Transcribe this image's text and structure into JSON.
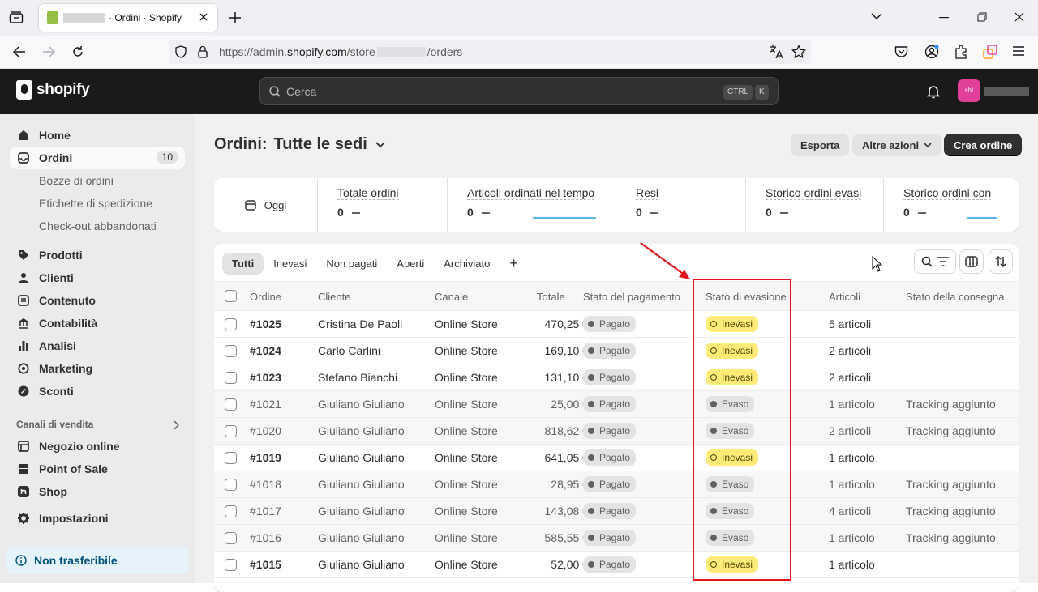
{
  "browser": {
    "tab_title": "· Ordini · Shopify",
    "url_prefix": "https://admin.",
    "url_domain": "shopify.com",
    "url_mid": "/store",
    "url_suffix": "/orders"
  },
  "topbar": {
    "logo": "shopify",
    "search_placeholder": "Cerca",
    "kbd_ctrl": "CTRL",
    "kbd_k": "K",
    "avatar": "sht"
  },
  "sidebar": {
    "home": "Home",
    "orders": "Ordini",
    "orders_count": "10",
    "drafts": "Bozze di ordini",
    "labels": "Etichette di spedizione",
    "abandoned": "Check-out abbandonati",
    "products": "Prodotti",
    "customers": "Clienti",
    "content": "Contenuto",
    "accounting": "Contabilità",
    "analytics": "Analisi",
    "marketing": "Marketing",
    "discounts": "Sconti",
    "sales_channels": "Canali di vendita",
    "online_store": "Negozio online",
    "pos": "Point of Sale",
    "shop": "Shop",
    "settings": "Impostazioni",
    "non_transferable": "Non trasferibile"
  },
  "header": {
    "title": "Ordini:",
    "location": "Tutte le sedi",
    "export": "Esporta",
    "more_actions": "Altre azioni",
    "create": "Crea ordine"
  },
  "stats": {
    "date": "Oggi",
    "items": [
      {
        "label": "Totale ordini",
        "value": "0"
      },
      {
        "label": "Articoli ordinati nel tempo",
        "value": "0"
      },
      {
        "label": "Resi",
        "value": "0"
      },
      {
        "label": "Storico ordini evasi",
        "value": "0"
      },
      {
        "label": "Storico ordini con",
        "value": "0"
      }
    ]
  },
  "tabs": [
    "Tutti",
    "Inevasi",
    "Non pagati",
    "Aperti",
    "Archiviato",
    "+"
  ],
  "columns": {
    "order": "Ordine",
    "customer": "Cliente",
    "channel": "Canale",
    "total": "Totale",
    "payment": "Stato del pagamento",
    "fulfillment": "Stato di evasione",
    "items": "Articoli",
    "delivery": "Stato della consegna"
  },
  "rows": [
    {
      "order": "#1025",
      "customer": "Cristina De Paoli",
      "channel": "Online Store",
      "total": "470,25 €",
      "payment": "Pagato",
      "fulfillment": "Inevasi",
      "items": "5 articoli",
      "delivery": ""
    },
    {
      "order": "#1024",
      "customer": "Carlo Carlini",
      "channel": "Online Store",
      "total": "169,10 €",
      "payment": "Pagato",
      "fulfillment": "Inevasi",
      "items": "2 articoli",
      "delivery": ""
    },
    {
      "order": "#1023",
      "customer": "Stefano Bianchi",
      "channel": "Online Store",
      "total": "131,10 €",
      "payment": "Pagato",
      "fulfillment": "Inevasi",
      "items": "2 articoli",
      "delivery": ""
    },
    {
      "order": "#1021",
      "customer": "Giuliano Giuliano",
      "channel": "Online Store",
      "total": "25,00 €",
      "payment": "Pagato",
      "fulfillment": "Evaso",
      "items": "1 articolo",
      "delivery": "Tracking aggiunto"
    },
    {
      "order": "#1020",
      "customer": "Giuliano Giuliano",
      "channel": "Online Store",
      "total": "818,62 €",
      "payment": "Pagato",
      "fulfillment": "Evaso",
      "items": "2 articoli",
      "delivery": "Tracking aggiunto"
    },
    {
      "order": "#1019",
      "customer": "Giuliano Giuliano",
      "channel": "Online Store",
      "total": "641,05 €",
      "payment": "Pagato",
      "fulfillment": "Inevasi",
      "items": "1 articolo",
      "delivery": ""
    },
    {
      "order": "#1018",
      "customer": "Giuliano Giuliano",
      "channel": "Online Store",
      "total": "28,95 €",
      "payment": "Pagato",
      "fulfillment": "Evaso",
      "items": "1 articolo",
      "delivery": "Tracking aggiunto"
    },
    {
      "order": "#1017",
      "customer": "Giuliano Giuliano",
      "channel": "Online Store",
      "total": "143,08 €",
      "payment": "Pagato",
      "fulfillment": "Evaso",
      "items": "4 articoli",
      "delivery": "Tracking aggiunto"
    },
    {
      "order": "#1016",
      "customer": "Giuliano Giuliano",
      "channel": "Online Store",
      "total": "585,55 €",
      "payment": "Pagato",
      "fulfillment": "Evaso",
      "items": "1 articolo",
      "delivery": "Tracking aggiunto"
    },
    {
      "order": "#1015",
      "customer": "Giuliano Giuliano",
      "channel": "Online Store",
      "total": "52,00 €",
      "payment": "Pagato",
      "fulfillment": "Inevasi",
      "items": "1 articolo",
      "delivery": ""
    }
  ],
  "colors": {
    "highlight": "#e0141a",
    "unfulfilled_badge": "#ffeb78",
    "sidebar_bg": "#ebebeb",
    "topbar_bg": "#1a1a1a"
  }
}
